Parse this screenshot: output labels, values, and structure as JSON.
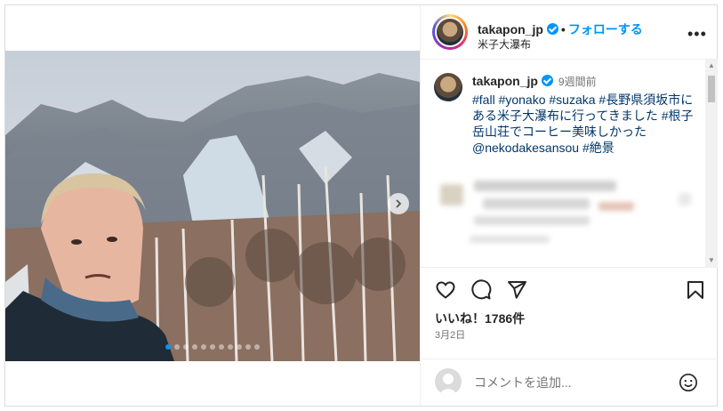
{
  "post": {
    "username": "takapon_jp",
    "follow_label": "フォローする",
    "separator": "•",
    "location": "米子大瀑布",
    "more_label": "•••"
  },
  "caption": {
    "username": "takapon_jp",
    "time": "9週間前",
    "text": "#fall #yonako #suzaka #長野県須坂市にある米子大瀑布に行ってきました #根子岳山荘でコーヒー美味しかった @nekodakesansou #絶景"
  },
  "carousel": {
    "dot_count": 11,
    "active_index": 0
  },
  "stats": {
    "likes": "いいね！1786件",
    "date": "3月2日"
  },
  "comment_box": {
    "placeholder": "コメントを追加..."
  },
  "colors": {
    "accent": "#0095f6",
    "text": "#262626",
    "muted": "#737373",
    "link": "#00376b"
  },
  "icons": [
    "verified-badge-icon",
    "more-options-icon",
    "next-arrow-icon",
    "heart-icon",
    "comment-icon",
    "share-icon",
    "bookmark-icon",
    "emoji-icon"
  ]
}
